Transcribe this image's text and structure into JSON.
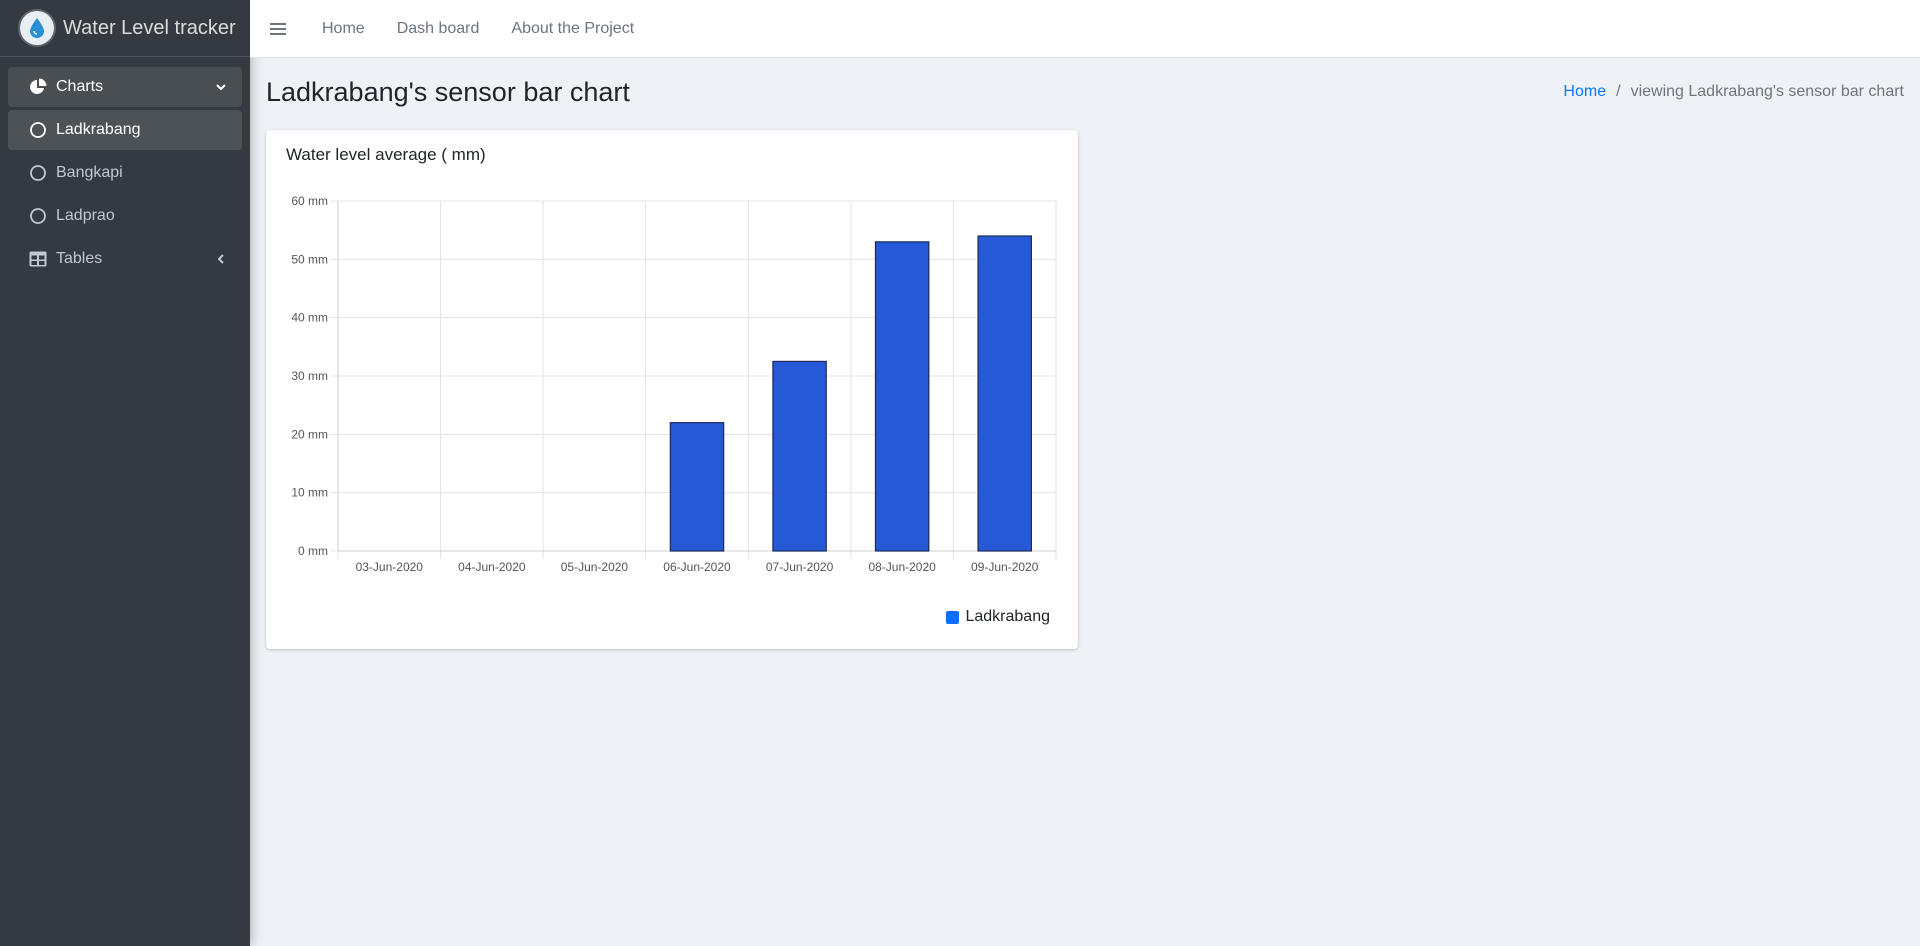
{
  "brand": {
    "name": "Water Level tracker",
    "logo_icon": "water-drop-icon"
  },
  "sidebar": {
    "items": [
      {
        "label": "Charts",
        "icon": "pie-chart-icon",
        "arrow": "chevron-down-icon"
      },
      {
        "label": "Ladkrabang",
        "icon": "circle-icon"
      },
      {
        "label": "Bangkapi",
        "icon": "circle-icon"
      },
      {
        "label": "Ladprao",
        "icon": "circle-icon"
      },
      {
        "label": "Tables",
        "icon": "table-icon",
        "arrow": "chevron-left-icon"
      }
    ]
  },
  "topbar": {
    "menu_icon": "hamburger-icon",
    "links": [
      "Home",
      "Dash board",
      "About the Project"
    ]
  },
  "header": {
    "title": "Ladkrabang's sensor bar chart",
    "breadcrumb": {
      "home": "Home",
      "current": "viewing Ladkrabang's sensor bar chart"
    }
  },
  "card": {
    "title": "Water level average ( mm)"
  },
  "colors": {
    "bar": "#2559d6",
    "legend": "#0d6efd",
    "sidebar": "#343a40",
    "link": "#007bff"
  },
  "chart_data": {
    "type": "bar",
    "categories": [
      "03-Jun-2020",
      "04-Jun-2020",
      "05-Jun-2020",
      "06-Jun-2020",
      "07-Jun-2020",
      "08-Jun-2020",
      "09-Jun-2020"
    ],
    "series": [
      {
        "name": "Ladkrabang",
        "values": [
          0,
          0,
          0,
          22,
          32.5,
          53,
          54
        ]
      }
    ],
    "ylim": [
      0,
      60
    ],
    "yticks": [
      "0 mm",
      "10 mm",
      "20 mm",
      "30 mm",
      "40 mm",
      "50 mm",
      "60 mm"
    ],
    "ytick_values": [
      0,
      10,
      20,
      30,
      40,
      50,
      60
    ],
    "grid": true,
    "legend_position": "bottom-right"
  }
}
